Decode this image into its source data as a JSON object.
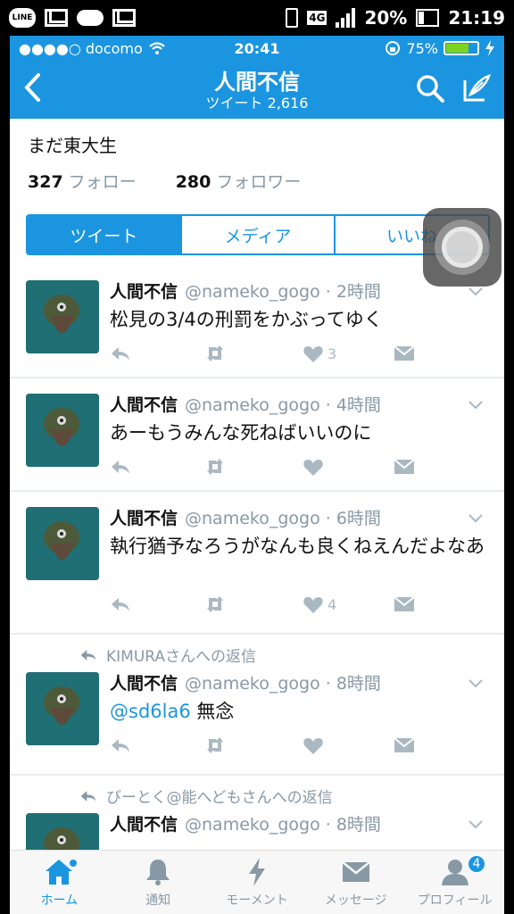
{
  "android_status": {
    "line_label": "LINE",
    "network": "4G",
    "battery": "20%",
    "time": "21:19"
  },
  "ios_status": {
    "carrier": "●●●●○ docomo",
    "time": "20:41",
    "battery": "75%"
  },
  "header": {
    "title": "人間不信",
    "subtitle": "ツイート 2,616"
  },
  "profile": {
    "bio": "まだ東大生",
    "following_count": "327",
    "following_label": "フォロー",
    "followers_count": "280",
    "followers_label": "フォロワー"
  },
  "tabs": [
    {
      "label": "ツイート"
    },
    {
      "label": "メディア"
    },
    {
      "label": "いいね"
    }
  ],
  "tweets": [
    {
      "name": "人間不信",
      "handle": "@nameko_gogo · 2時間",
      "text": "松見の3/4の刑罰をかぶってゆく",
      "likes": "3"
    },
    {
      "name": "人間不信",
      "handle": "@nameko_gogo · 4時間",
      "text": "あーもうみんな死ねばいいのに",
      "likes": ""
    },
    {
      "name": "人間不信",
      "handle": "@nameko_gogo · 6時間",
      "text": "執行猶予なろうがなんも良くねえんだよなあ",
      "likes": "4"
    },
    {
      "name": "人間不信",
      "handle": "@nameko_gogo · 8時間",
      "reply_context": "KIMURAさんへの返信",
      "mention": "@sd6la6",
      "text": " 無念",
      "likes": ""
    },
    {
      "name": "人間不信",
      "handle": "@nameko_gogo · 8時間",
      "reply_context": "びーとく@能へどもさんへの返信"
    }
  ],
  "tabbar": [
    {
      "label": "ホーム",
      "icon": "home-icon"
    },
    {
      "label": "通知",
      "icon": "bell-icon"
    },
    {
      "label": "モーメント",
      "icon": "lightning-icon"
    },
    {
      "label": "メッセージ",
      "icon": "envelope-icon"
    },
    {
      "label": "プロフィール",
      "icon": "person-icon",
      "badge": "4"
    }
  ],
  "colors": {
    "brand": "#1b95e0",
    "muted": "#8899a6",
    "action": "#aab8c2"
  }
}
